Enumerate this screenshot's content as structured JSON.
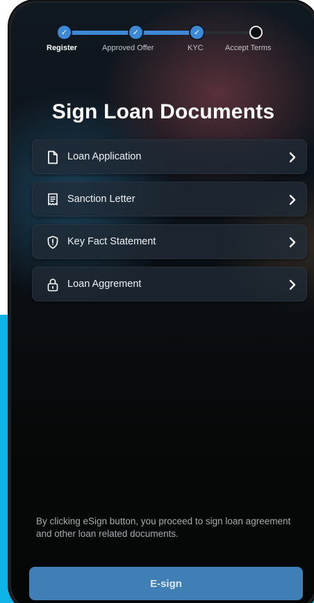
{
  "stepper": {
    "steps": [
      {
        "label": "Register",
        "state": "done",
        "active": true
      },
      {
        "label": "Approved Offer",
        "state": "done",
        "active": false
      },
      {
        "label": "KYC",
        "state": "done",
        "active": false
      },
      {
        "label": "Accept Terms",
        "state": "pending",
        "active": false
      }
    ],
    "check_glyph": "✓"
  },
  "page": {
    "title": "Sign Loan Documents"
  },
  "documents": [
    {
      "label": "Loan Application",
      "icon": "document-icon"
    },
    {
      "label": "Sanction Letter",
      "icon": "receipt-icon"
    },
    {
      "label": "Key Fact Statement",
      "icon": "shield-icon"
    },
    {
      "label": "Loan Aggrement",
      "icon": "lock-icon"
    }
  ],
  "footer": {
    "disclaimer": "By clicking eSign button, you proceed to sign loan agreement and other loan related documents.",
    "esign_label": "E-sign"
  },
  "colors": {
    "accent": "#3d89d6",
    "button": "#3f7fb5",
    "background_band": "#10b3e6"
  }
}
